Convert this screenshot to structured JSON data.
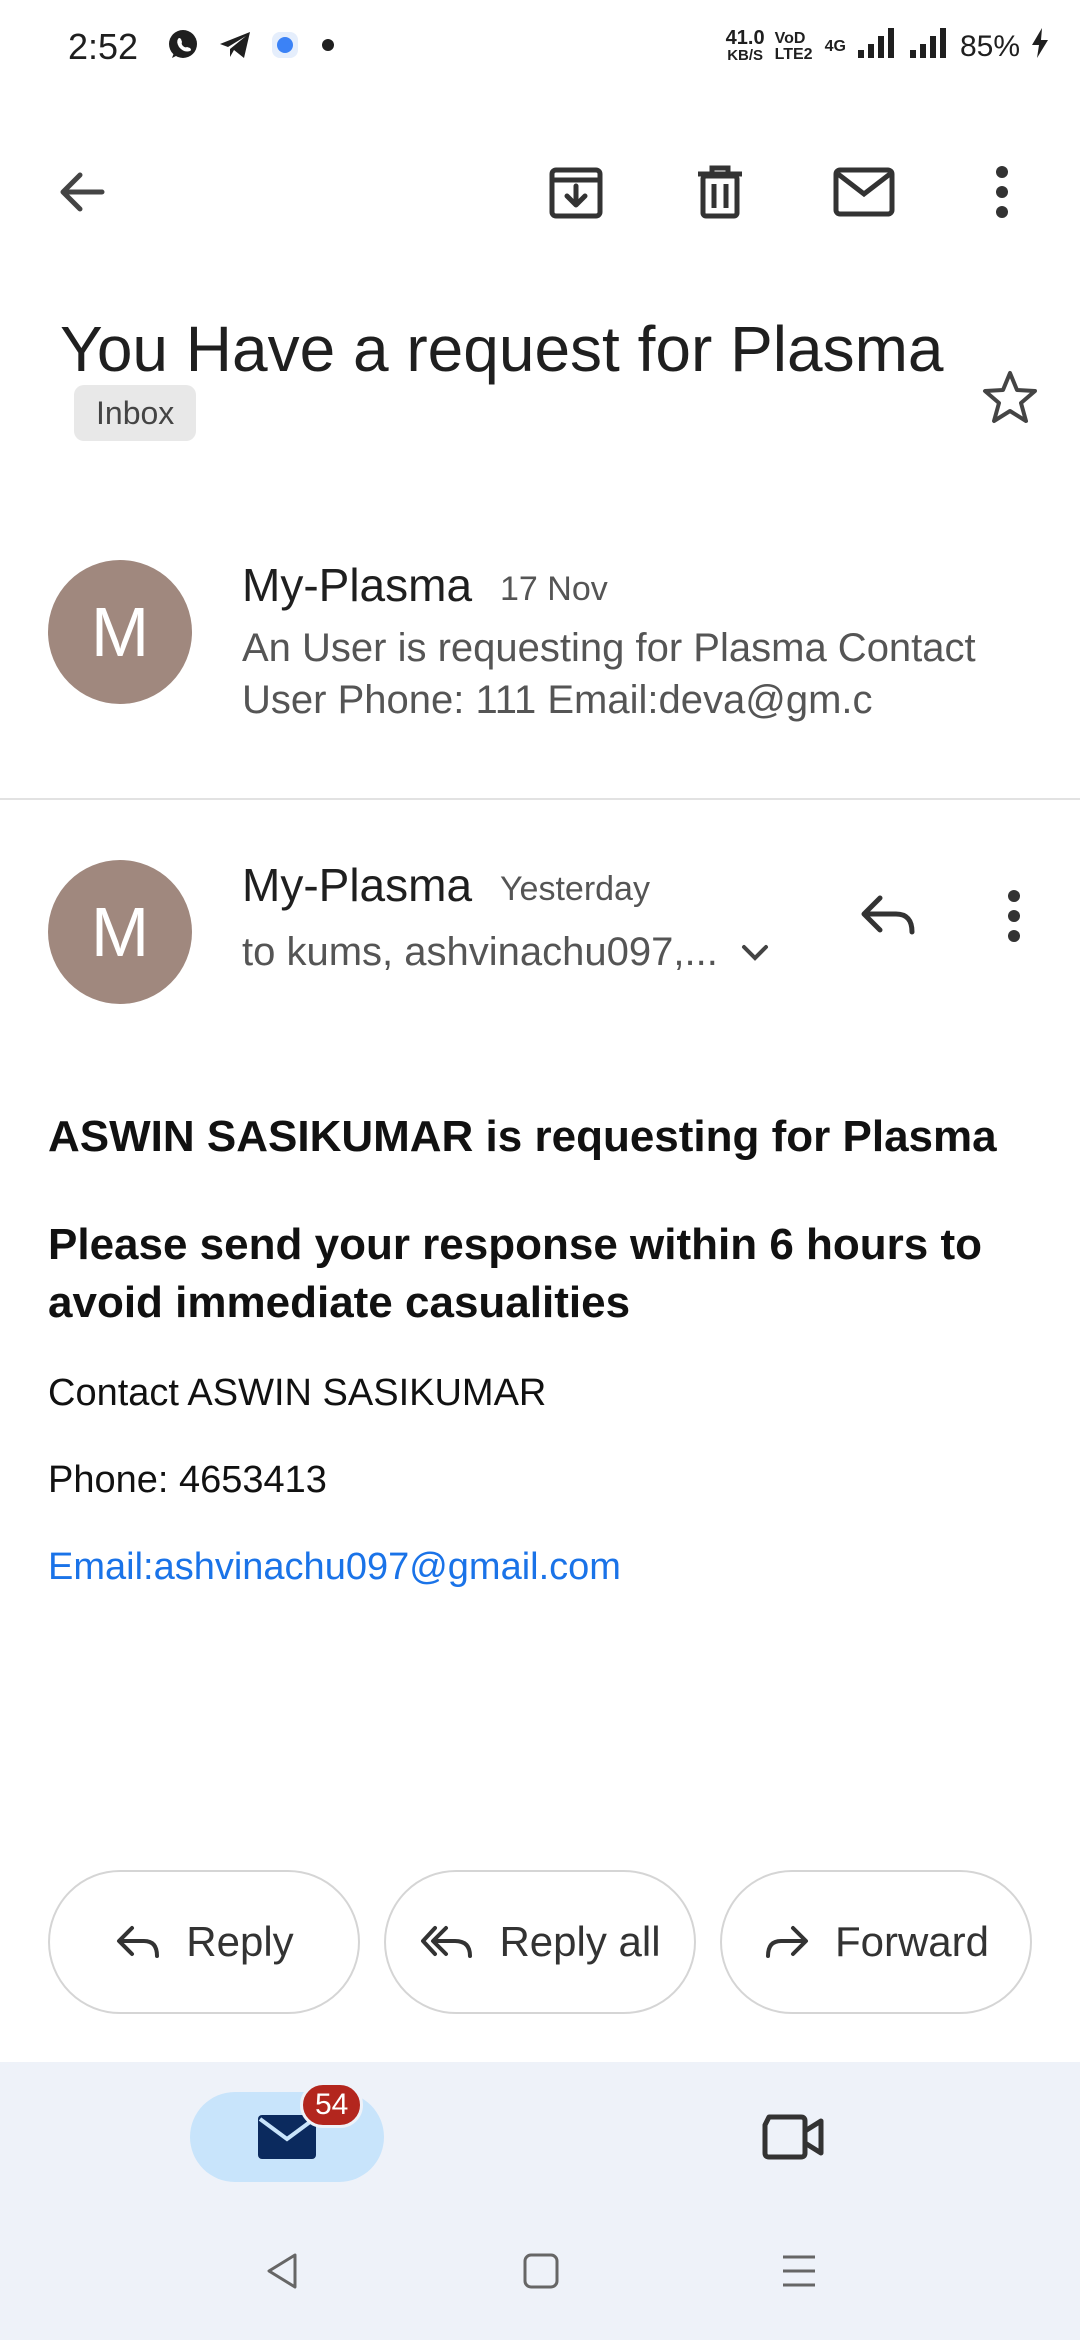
{
  "status_bar": {
    "time": "2:52",
    "net_speed_value": "41.0",
    "net_speed_unit": "KB/S",
    "network_label": "VoD LTE2",
    "network_type": "4G",
    "battery": "85%",
    "icons": [
      "whatsapp-icon",
      "telegram-icon",
      "app-icon",
      "dot-icon",
      "signal-icon",
      "battery-charging-icon"
    ]
  },
  "toolbar": {
    "icons": [
      "back-arrow-icon",
      "archive-icon",
      "delete-icon",
      "mark-unread-icon",
      "more-vert-icon"
    ]
  },
  "email": {
    "subject": "You Have a request for Plasma",
    "label": "Inbox",
    "collapsed_message": {
      "avatar_letter": "M",
      "sender": "My-Plasma",
      "date": "17 Nov",
      "snippet_line1": "An User is requesting for Plasma Contact",
      "snippet_line2": "User Phone: 111 Email:deva@gm.c"
    },
    "expanded_message": {
      "avatar_letter": "M",
      "sender": "My-Plasma",
      "date": "Yesterday",
      "recipients": "to kums, ashvinachu097,...",
      "body": {
        "heading1": "ASWIN SASIKUMAR is requesting for Plasma",
        "heading2": "Please send your response within 6 hours to avoid immediate casualities",
        "contact": "Contact ASWIN SASIKUMAR",
        "phone": "Phone: 4653413",
        "email_link": "Email:ashvinachu097@gmail.com"
      }
    }
  },
  "actions": {
    "reply": "Reply",
    "reply_all": "Reply all",
    "forward": "Forward"
  },
  "bottom_nav": {
    "mail_badge": "54",
    "tabs": [
      "mail-icon",
      "video-icon"
    ]
  },
  "colors": {
    "avatar": "#a0887e",
    "link": "#1a73e8",
    "badge": "#b3261e",
    "mail_tab_active": "#c8e4fb",
    "nav_background": "#eef2f9"
  }
}
